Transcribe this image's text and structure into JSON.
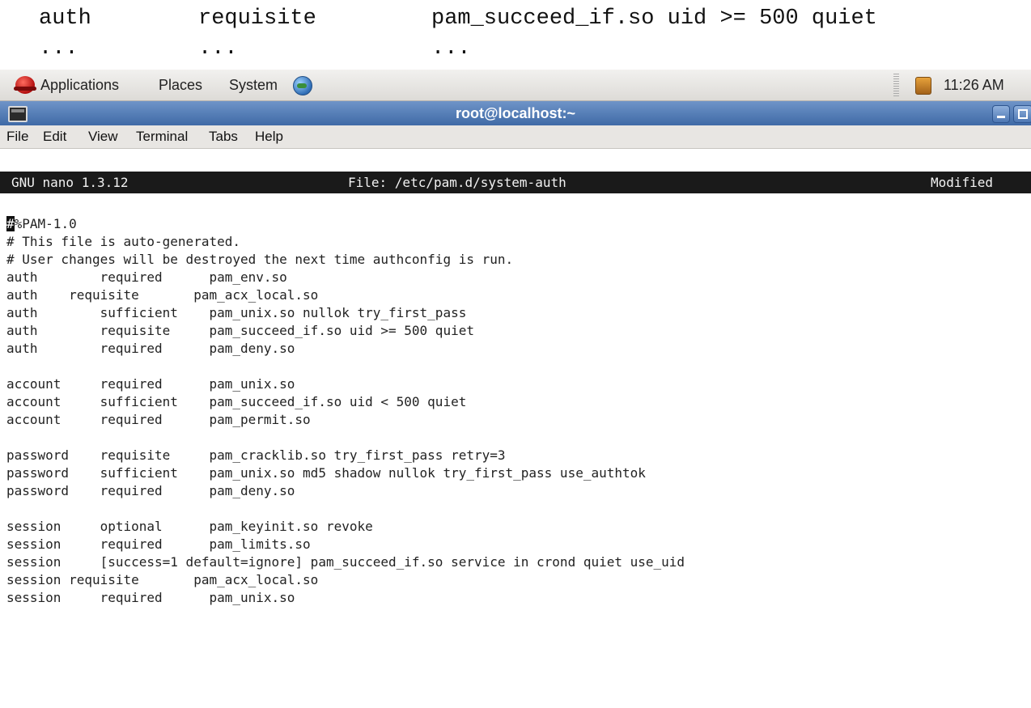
{
  "caption": {
    "row1": [
      "auth",
      "requisite",
      "pam_succeed_if.so uid >= 500 quiet"
    ],
    "row2": [
      "...",
      "...",
      "..."
    ]
  },
  "panel": {
    "applications": "Applications",
    "places": "Places",
    "system": "System",
    "clock": "11:26 AM",
    "icons": [
      "redhat-icon",
      "browser-globe-icon",
      "notification-icon"
    ]
  },
  "window": {
    "title": "root@localhost:~"
  },
  "menubar": {
    "file": "File",
    "edit": "Edit",
    "view": "View",
    "terminal": "Terminal",
    "tabs": "Tabs",
    "help": "Help"
  },
  "nano": {
    "version": "GNU nano 1.3.12",
    "file": "File: /etc/pam.d/system-auth",
    "status": "Modified",
    "cursor_char": "#",
    "first_line_rest": "%PAM-1.0",
    "lines": [
      "# This file is auto-generated.",
      "# User changes will be destroyed the next time authconfig is run.",
      "auth        required      pam_env.so",
      "auth    requisite       pam_acx_local.so",
      "auth        sufficient    pam_unix.so nullok try_first_pass",
      "auth        requisite     pam_succeed_if.so uid >= 500 quiet",
      "auth        required      pam_deny.so",
      "",
      "account     required      pam_unix.so",
      "account     sufficient    pam_succeed_if.so uid < 500 quiet",
      "account     required      pam_permit.so",
      "",
      "password    requisite     pam_cracklib.so try_first_pass retry=3",
      "password    sufficient    pam_unix.so md5 shadow nullok try_first_pass use_authtok",
      "password    required      pam_deny.so",
      "",
      "session     optional      pam_keyinit.so revoke",
      "session     required      pam_limits.so",
      "session     [success=1 default=ignore] pam_succeed_if.so service in crond quiet use_uid",
      "session requisite       pam_acx_local.so",
      "session     required      pam_unix.so"
    ]
  }
}
